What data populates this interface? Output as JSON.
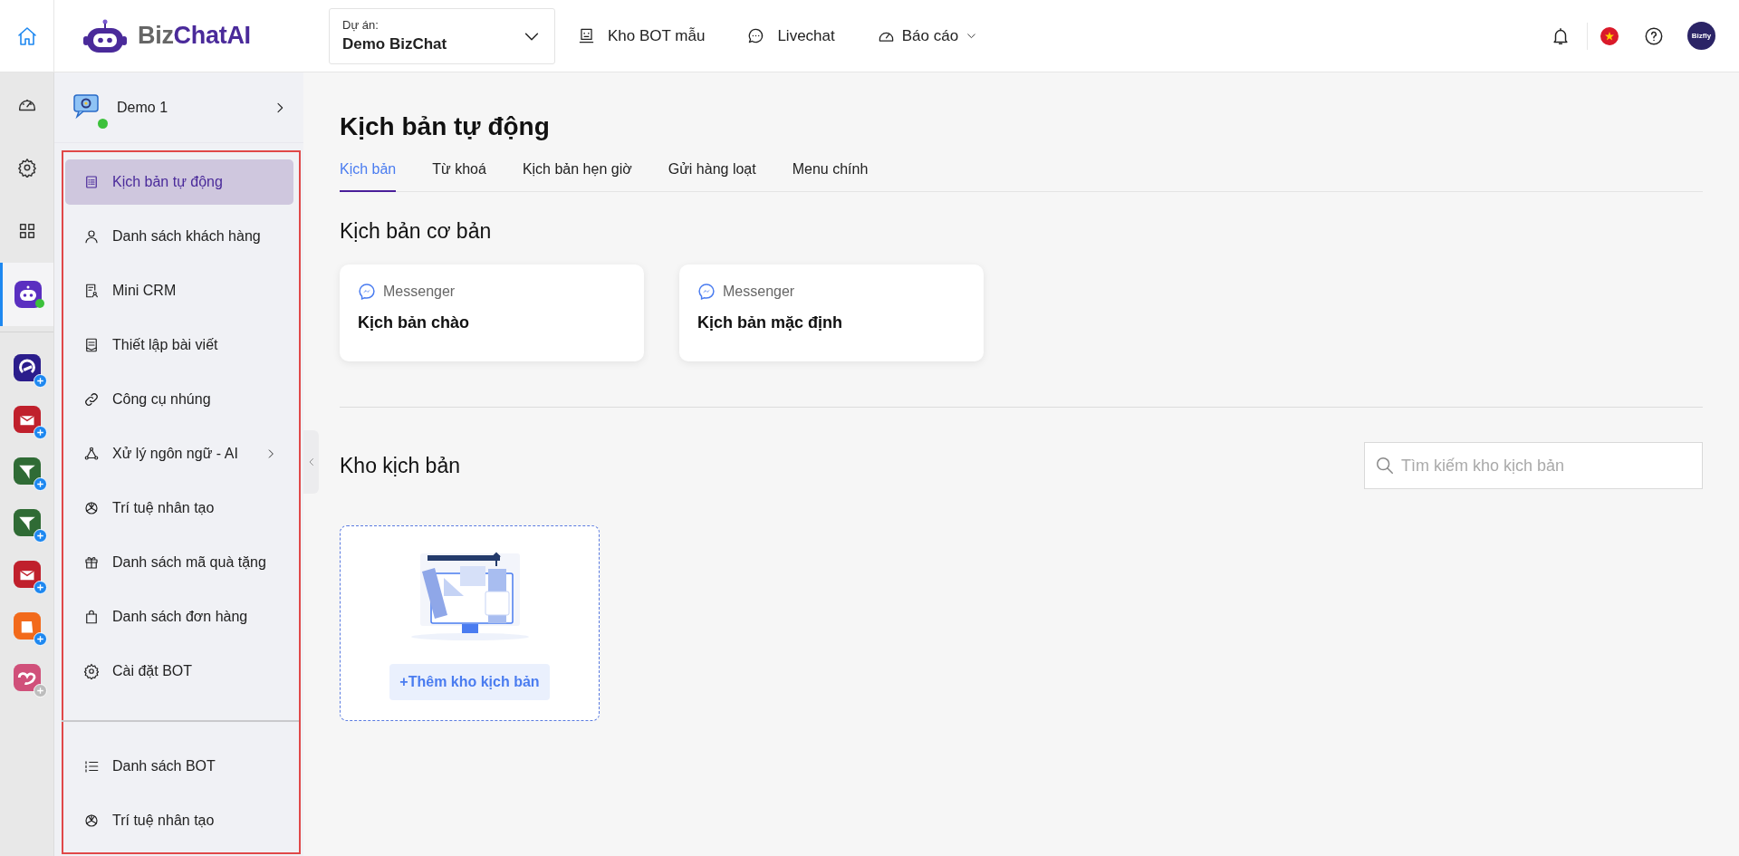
{
  "topbar": {
    "brand_prefix": "Biz",
    "brand_name": "ChatAI",
    "project_label": "Dự án:",
    "project_value": "Demo BizChat",
    "nav": [
      {
        "label": "Kho BOT mẫu",
        "kind": "templates"
      },
      {
        "label": "Livechat",
        "kind": "chat"
      },
      {
        "label": "Báo cáo",
        "kind": "reports",
        "dropdown": true
      }
    ],
    "account_badge": "Bizfly"
  },
  "rail": {
    "tools": [
      {
        "kind": "dashboard",
        "selected": false
      },
      {
        "kind": "settings",
        "selected": false
      },
      {
        "kind": "grid",
        "selected": false
      },
      {
        "kind": "bot",
        "selected": true,
        "online": true
      }
    ],
    "apps": [
      {
        "color": "#2b1d8c",
        "kind": "swirl",
        "enabled": true
      },
      {
        "color": "#c0202c",
        "kind": "mail",
        "enabled": true
      },
      {
        "color": "#2f6b35",
        "kind": "plane",
        "enabled": true
      },
      {
        "color": "#2f6b35",
        "kind": "plane",
        "enabled": true
      },
      {
        "color": "#c0202c",
        "kind": "mail",
        "enabled": true
      },
      {
        "color": "#f26a1b",
        "kind": "bag",
        "enabled": true
      },
      {
        "color": "#d0507a",
        "kind": "heart",
        "enabled": false
      }
    ]
  },
  "sidebar": {
    "bot_name": "Demo 1",
    "online": true,
    "highlighted": true,
    "items": [
      {
        "label": "Kịch bản tự động",
        "kind": "script",
        "selected": true,
        "submenu": false
      },
      {
        "label": "Danh sách khách hàng",
        "kind": "user",
        "selected": false,
        "submenu": false
      },
      {
        "label": "Mini CRM",
        "kind": "crm",
        "selected": false,
        "submenu": false
      },
      {
        "label": "Thiết lập bài viết",
        "kind": "post",
        "selected": false,
        "submenu": false
      },
      {
        "label": "Công cụ nhúng",
        "kind": "link",
        "selected": false,
        "submenu": false
      },
      {
        "label": "Xử lý ngôn ngữ - AI",
        "kind": "nodes",
        "selected": false,
        "submenu": true
      },
      {
        "label": "Trí tuệ nhân tạo",
        "kind": "ai",
        "selected": false,
        "submenu": false
      },
      {
        "label": "Danh sách mã quà tặng",
        "kind": "gift",
        "selected": false,
        "submenu": false
      },
      {
        "label": "Danh sách đơn hàng",
        "kind": "bag",
        "selected": false,
        "submenu": false
      },
      {
        "label": "Cài đặt BOT",
        "kind": "settings",
        "selected": false,
        "submenu": false
      }
    ],
    "footer_items": [
      {
        "label": "Danh sách BOT",
        "kind": "numbered",
        "selected": false
      },
      {
        "label": "Trí tuệ nhân tạo",
        "kind": "ai",
        "selected": false
      }
    ]
  },
  "main": {
    "title": "Kịch bản tự động",
    "tabs": [
      {
        "label": "Kịch bản",
        "selected": true
      },
      {
        "label": "Từ khoá",
        "selected": false
      },
      {
        "label": "Kịch bản hẹn giờ",
        "selected": false
      },
      {
        "label": "Gửi hàng loạt",
        "selected": false
      },
      {
        "label": "Menu chính",
        "selected": false
      }
    ],
    "basic_section": {
      "heading": "Kịch bản cơ bản",
      "cards": [
        {
          "channel": "Messenger",
          "title": "Kịch bản chào"
        },
        {
          "channel": "Messenger",
          "title": "Kịch bản mặc định"
        }
      ]
    },
    "library_section": {
      "heading": "Kho kịch bản",
      "search": {
        "placeholder": "Tìm kiếm kho kịch bản"
      },
      "add_button": "+Thêm kho kịch bản"
    }
  }
}
